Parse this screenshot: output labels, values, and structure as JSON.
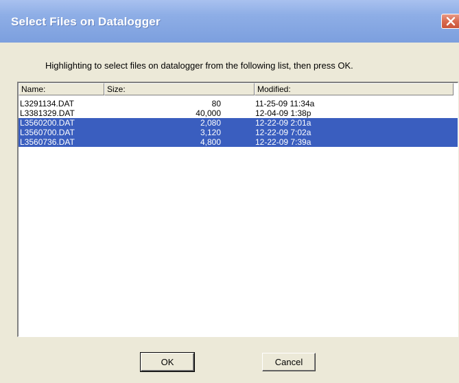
{
  "window": {
    "title": "Select Files on Datalogger",
    "close_glyph": "✕",
    "title_color": "#ffffff",
    "titlebar_color": "#8eaee6"
  },
  "instruction": "Highlighting to select files on datalogger from the following list, then press OK.",
  "list": {
    "columns": [
      "Name:",
      "Size:",
      "Modified:"
    ],
    "selection_color": "#3a5ebf",
    "rows": [
      {
        "name": "L3291134.DAT",
        "size": "80",
        "modified": "11-25-09 11:34a",
        "selected": false
      },
      {
        "name": "L3381329.DAT",
        "size": "40,000",
        "modified": "12-04-09  1:38p",
        "selected": false
      },
      {
        "name": "L3560200.DAT",
        "size": "2,080",
        "modified": "12-22-09  2:01a",
        "selected": true
      },
      {
        "name": "L3560700.DAT",
        "size": "3,120",
        "modified": "12-22-09  7:02a",
        "selected": true
      },
      {
        "name": "L3560736.DAT",
        "size": "4,800",
        "modified": "12-22-09  7:39a",
        "selected": true
      }
    ]
  },
  "buttons": {
    "ok_label": "OK",
    "cancel_label": "Cancel"
  }
}
